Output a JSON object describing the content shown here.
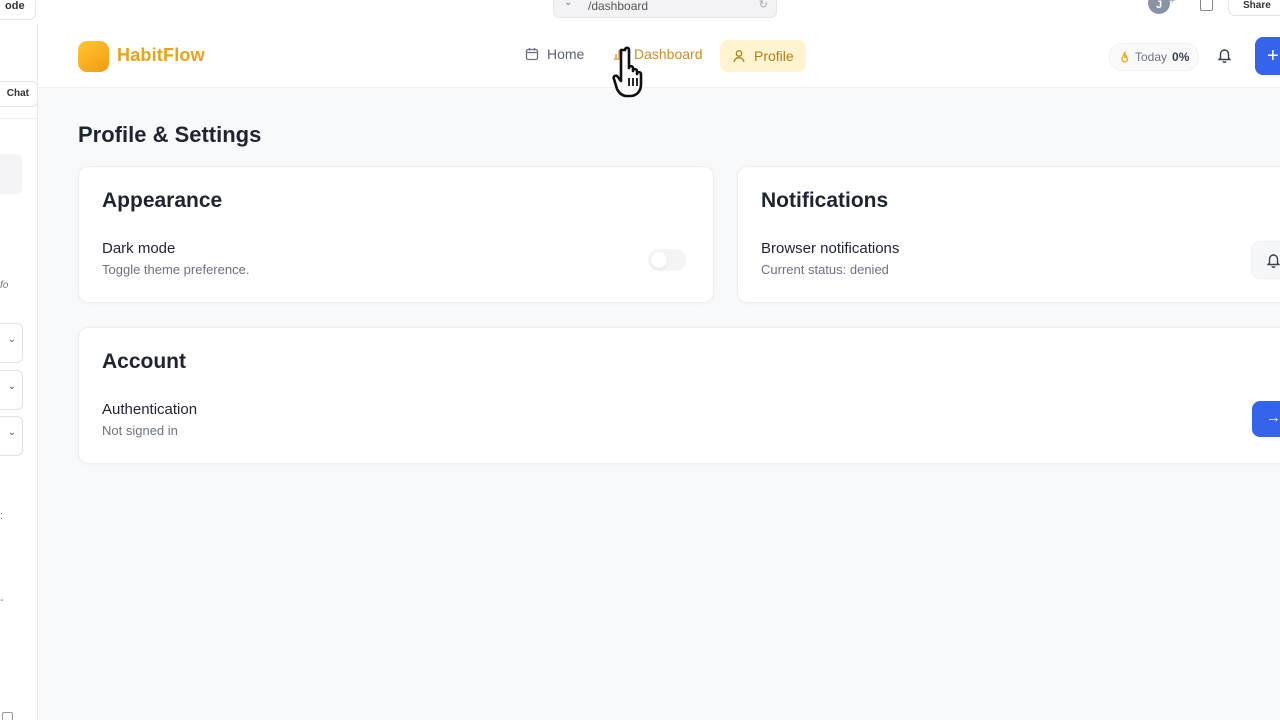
{
  "chrome": {
    "mode_tab": "ode",
    "url_path": "/dashboard",
    "avatar_initial": "J",
    "share_label": "Share",
    "left_chat_label": "Chat",
    "left_fragment": "fo",
    "left_colon": ":",
    "left_dash": "-"
  },
  "app": {
    "brand": "HabitFlow",
    "nav": {
      "home": "Home",
      "dashboard": "Dashboard",
      "profile": "Profile"
    },
    "today_label": "Today",
    "today_value": "0%",
    "cta_glyph": "+"
  },
  "page": {
    "title": "Profile & Settings"
  },
  "appearance": {
    "title": "Appearance",
    "dark_mode_label": "Dark mode",
    "dark_mode_desc": "Toggle theme preference.",
    "dark_mode_on": false
  },
  "notifications": {
    "title": "Notifications",
    "browser_label": "Browser notifications",
    "browser_status": "Current status: denied"
  },
  "account": {
    "title": "Account",
    "auth_label": "Authentication",
    "auth_status": "Not signed in",
    "signin_glyph": "→"
  },
  "colors": {
    "brand": "#e8a317",
    "primary": "#3563e9",
    "profile_pill_bg": "#fff4cf"
  }
}
